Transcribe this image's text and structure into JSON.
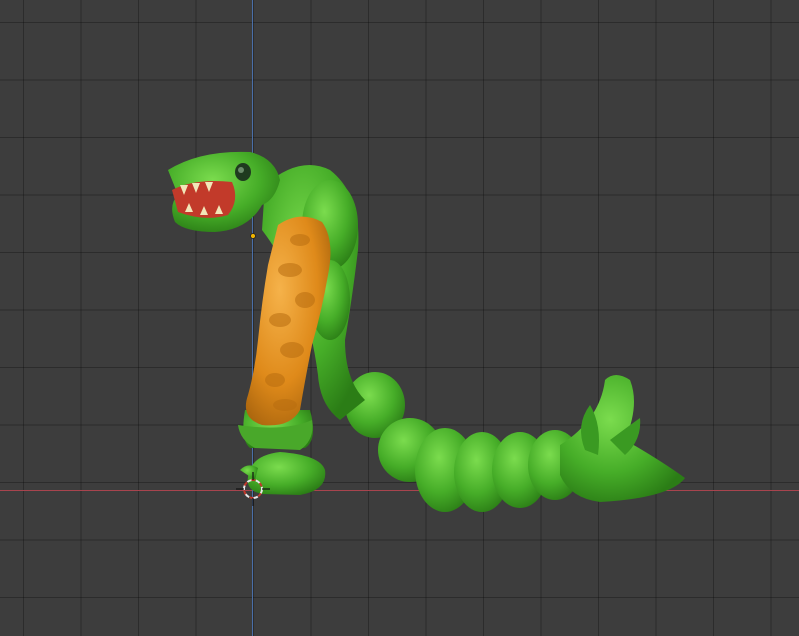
{
  "viewport": {
    "background": "#3d3d3d",
    "grid_color": "#2f2f2f",
    "x_axis_color": "#a8444e",
    "y_axis_color": "#4a6fa8"
  },
  "scene": {
    "object": "creature-sculpt",
    "body_color": "#4fb52f",
    "arm_color": "#e28c1a",
    "mouth_color": "#d84a3a",
    "origin_marker_color": "#f0b400",
    "cursor_icon": "3d-cursor-icon"
  }
}
